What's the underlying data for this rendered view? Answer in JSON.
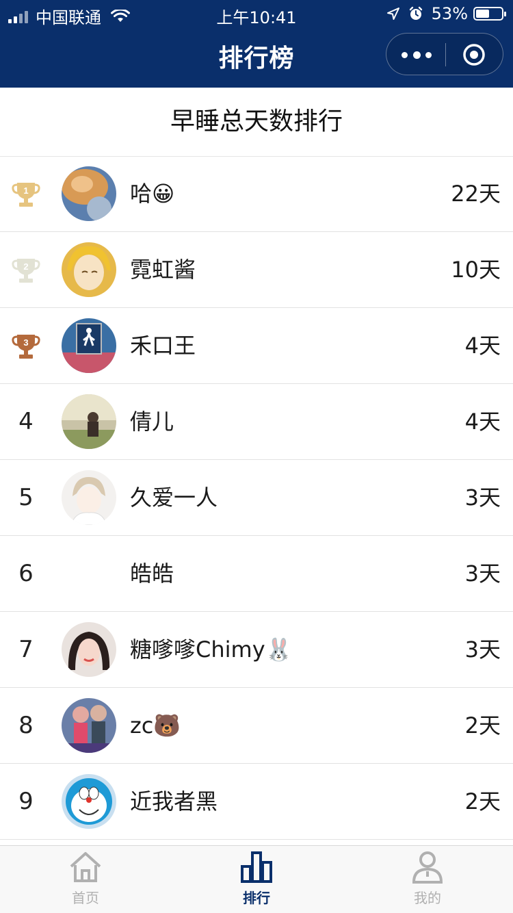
{
  "status_bar": {
    "carrier": "中国联通",
    "time": "上午10:41",
    "battery": "53%",
    "battery_level": 0.53
  },
  "nav": {
    "title": "排行榜",
    "more_icon": "more-dots-icon",
    "close_icon": "target-circle-icon"
  },
  "page": {
    "title": "早睡总天数排行"
  },
  "ranking": [
    {
      "rank": "1",
      "name": "哈😀",
      "days": "22天",
      "medal": "gold"
    },
    {
      "rank": "2",
      "name": "霓虹酱",
      "days": "10天",
      "medal": "silver"
    },
    {
      "rank": "3",
      "name": "禾口王",
      "days": "4天",
      "medal": "bronze"
    },
    {
      "rank": "4",
      "name": "倩儿",
      "days": "4天"
    },
    {
      "rank": "5",
      "name": "久爱一人",
      "days": "3天"
    },
    {
      "rank": "6",
      "name": "皓皓",
      "days": "3天"
    },
    {
      "rank": "7",
      "name": "糖嗲嗲Chimy🐰",
      "days": "3天"
    },
    {
      "rank": "8",
      "name": "zc🐻",
      "days": "2天"
    },
    {
      "rank": "9",
      "name": "近我者黑",
      "days": "2天"
    }
  ],
  "tabs": [
    {
      "label": "首页",
      "icon": "home-icon",
      "active": false
    },
    {
      "label": "排行",
      "icon": "bar-chart-icon",
      "active": true
    },
    {
      "label": "我的",
      "icon": "user-icon",
      "active": false
    }
  ],
  "colors": {
    "header_bg": "#0a2f6b",
    "tab_active": "#0a2f6b",
    "tab_inactive": "#b0b0b0",
    "medal_gold": "#e6c47f",
    "medal_silver": "#e2e2d4",
    "medal_bronze": "#b46a3c"
  }
}
